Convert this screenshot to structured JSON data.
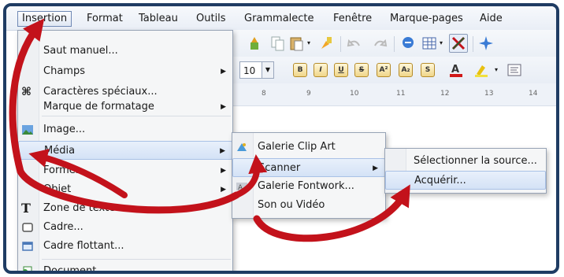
{
  "menubar": {
    "items": [
      "Insertion",
      "Format",
      "Tableau",
      "Outils",
      "Grammalecte",
      "Fenêtre",
      "Marque-pages",
      "Aide"
    ]
  },
  "toolbar": {
    "font_size": "10",
    "ruler_numbers": [
      "8",
      "9",
      "10",
      "11",
      "12",
      "13",
      "14"
    ]
  },
  "insertion_menu": {
    "items": [
      {
        "label": "Saut manuel...",
        "icon": "",
        "submenu": false
      },
      {
        "label": "Champs",
        "icon": "",
        "submenu": true
      },
      {
        "label": "Caractères spéciaux...",
        "icon": "omega-icon",
        "submenu": false
      },
      {
        "label": "Marque de formatage",
        "icon": "",
        "submenu": true
      },
      {
        "label": "Image...",
        "icon": "image-icon",
        "submenu": false
      },
      {
        "label": "Média",
        "icon": "",
        "submenu": true
      },
      {
        "label": "Formes",
        "icon": "",
        "submenu": true
      },
      {
        "label": "Objet",
        "icon": "",
        "submenu": true
      },
      {
        "label": "Zone de texte",
        "icon": "text-box-icon",
        "submenu": false
      },
      {
        "label": "Cadre...",
        "icon": "frame-icon",
        "submenu": false
      },
      {
        "label": "Cadre flottant...",
        "icon": "floating-frame-icon",
        "submenu": false
      },
      {
        "label": "Document...",
        "icon": "document-icon",
        "submenu": false
      }
    ]
  },
  "media_menu": {
    "items": [
      {
        "label": "Galerie Clip Art",
        "icon": "gallery-icon",
        "submenu": false
      },
      {
        "label": "Scanner",
        "icon": "",
        "submenu": true
      },
      {
        "label": "Galerie Fontwork...",
        "icon": "fontwork-icon",
        "submenu": false
      },
      {
        "label": "Son ou Vidéo",
        "icon": "",
        "submenu": false
      }
    ]
  },
  "scanner_menu": {
    "items": [
      {
        "label": "Sélectionner la source..."
      },
      {
        "label": "Acquérir..."
      }
    ]
  },
  "colors": {
    "frame": "#1f3c63",
    "arrow": "#c3121b",
    "highlight": "#d4e2f6"
  }
}
